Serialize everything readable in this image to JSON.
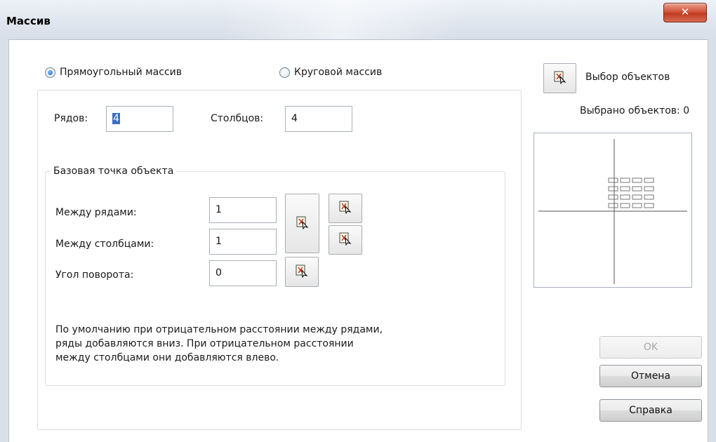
{
  "window": {
    "title": "Массив",
    "close_icon": "close-icon"
  },
  "mode": {
    "rect_label": "Прямоугольный массив",
    "rect_selected": true,
    "polar_label": "Круговой массив",
    "polar_selected": false
  },
  "grid": {
    "rows_label": "Рядов:",
    "rows_value": "4",
    "cols_label": "Столбцов:",
    "cols_value": "4"
  },
  "offsets": {
    "group_label": "Базовая точка объекта",
    "row_offset_label": "Между рядами:",
    "row_offset_value": "1",
    "col_offset_label": "Между столбцами:",
    "col_offset_value": "1",
    "angle_label": "Угол поворота:",
    "angle_value": "0"
  },
  "note": "По умолчанию при отрицательном расстоянии между рядами,\nряды добавляются вниз. При отрицательном расстоянии\nмежду столбцами они добавляются влево.",
  "selection": {
    "button_label": "Выбор объектов",
    "count_text": "Выбрано объектов: 0"
  },
  "buttons": {
    "ok": "OK",
    "cancel": "Отмена",
    "help": "Справка"
  },
  "colors": {
    "accent": "#1d63b6",
    "close": "#c9452b"
  }
}
